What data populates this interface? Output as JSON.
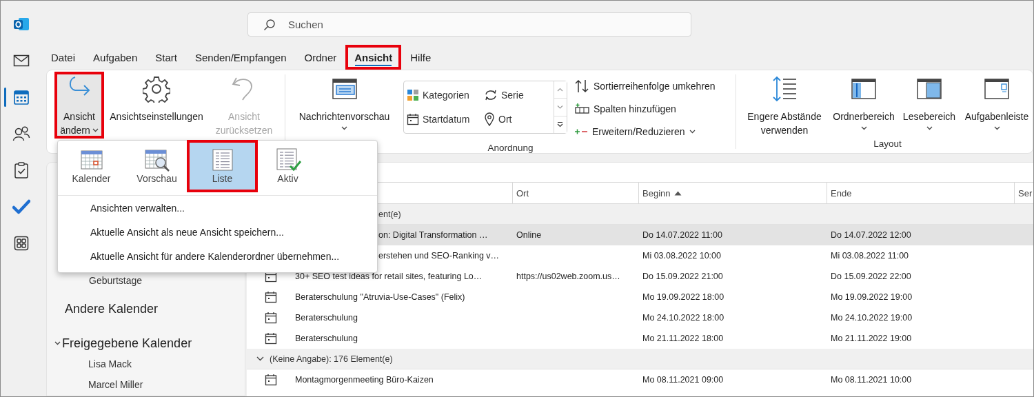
{
  "rail": [
    {
      "kind": "logo",
      "selected": false
    },
    {
      "kind": "mail",
      "selected": false
    },
    {
      "kind": "calendar",
      "selected": true
    },
    {
      "kind": "people",
      "selected": false
    },
    {
      "kind": "tasks",
      "selected": false
    },
    {
      "kind": "todo",
      "selected": false
    },
    {
      "kind": "apps",
      "selected": false
    }
  ],
  "search": {
    "placeholder": "Suchen"
  },
  "menu_tabs": [
    {
      "label": "Datei",
      "selected": false,
      "highlighted": false
    },
    {
      "label": "Aufgaben",
      "selected": false,
      "highlighted": false
    },
    {
      "label": "Start",
      "selected": false,
      "highlighted": false
    },
    {
      "label": "Senden/Empfangen",
      "selected": false,
      "highlighted": false
    },
    {
      "label": "Ordner",
      "selected": false,
      "highlighted": false
    },
    {
      "label": "Ansicht",
      "selected": true,
      "highlighted": true
    },
    {
      "label": "Hilfe",
      "selected": false,
      "highlighted": false
    }
  ],
  "ribbon": {
    "view_buttons": [
      {
        "lines": [
          "Ansicht",
          "ändern"
        ],
        "dropdown": true,
        "disabled": false,
        "highlighted": true
      },
      {
        "lines": [
          "Ansichtseinstellungen"
        ],
        "dropdown": false,
        "disabled": false,
        "highlighted": false
      },
      {
        "lines": [
          "Ansicht",
          "zurücksetzen"
        ],
        "dropdown": false,
        "disabled": true,
        "highlighted": false
      }
    ],
    "arrangement": {
      "label": "Anordnung",
      "preview_button": {
        "lines": [
          "Nachrichtenvorschau"
        ],
        "dropdown": true,
        "disabled": false,
        "highlighted": false
      },
      "gallery": [
        {
          "label": "Kategorien"
        },
        {
          "label": "Serie"
        },
        {
          "label": "Startdatum"
        },
        {
          "label": "Ort"
        }
      ],
      "commands": [
        {
          "label": "Sortierreihenfolge umkehren",
          "dropdown": false
        },
        {
          "label": "Spalten hinzufügen",
          "dropdown": false
        },
        {
          "label": "Erweitern/Reduzieren",
          "dropdown": true
        }
      ]
    },
    "layout": {
      "label": "Layout",
      "buttons": [
        {
          "lines": [
            "Engere Abstände",
            "verwenden"
          ],
          "dropdown": false,
          "disabled": false,
          "highlighted": false
        },
        {
          "lines": [
            "Ordnerbereich"
          ],
          "dropdown": true,
          "disabled": false,
          "highlighted": false
        },
        {
          "lines": [
            "Lesebereich"
          ],
          "dropdown": true,
          "disabled": false,
          "highlighted": false
        },
        {
          "lines": [
            "Aufgabenleiste"
          ],
          "dropdown": true,
          "disabled": false,
          "highlighted": false
        }
      ]
    }
  },
  "view_menu": {
    "views": [
      {
        "label": "Kalender",
        "selected": false,
        "highlighted": false
      },
      {
        "label": "Vorschau",
        "selected": false,
        "highlighted": false
      },
      {
        "label": "Liste",
        "selected": true,
        "highlighted": true
      },
      {
        "label": "Aktiv",
        "selected": false,
        "highlighted": false
      }
    ],
    "commands": [
      "Ansichten verwalten...",
      "Aktuelle Ansicht als neue Ansicht speichern...",
      "Aktuelle Ansicht für andere Kalenderordner übernehmen..."
    ]
  },
  "sidebar": {
    "items": [
      {
        "kind": "calendar",
        "label": "Geburtstage"
      },
      {
        "kind": "group",
        "label": "Andere Kalender"
      },
      {
        "kind": "group",
        "label": "Freigegebene Kalender",
        "expanded": true,
        "children": [
          {
            "label": "Lisa Mack"
          },
          {
            "label": "Marcel Miller"
          }
        ]
      }
    ]
  },
  "list": {
    "columns": [
      {
        "label": "Ort",
        "sorted": false
      },
      {
        "label": "Beginn",
        "sorted": true
      },
      {
        "label": "Ende",
        "sorted": false
      },
      {
        "label": "Ser",
        "sorted": false
      }
    ],
    "groups": [
      {
        "header": "ent(e)",
        "partial": true,
        "rows": [
          {
            "title": "on: Digital Transformation …",
            "location": "Online",
            "start": "Do 14.07.2022 11:00",
            "end": "Do 14.07.2022 12:00",
            "selected": true,
            "partial": true
          },
          {
            "title": "erstehen und SEO-Ranking v…",
            "start": "Mi 03.08.2022 10:00",
            "end": "Mi 03.08.2022 11:00",
            "selected": false,
            "partial": true
          },
          {
            "title": "30+ SEO test ideas for retail sites, featuring Lo…",
            "location": "https://us02web.zoom.us…",
            "start": "Do 15.09.2022 21:00",
            "end": "Do 15.09.2022 22:00",
            "selected": false,
            "partial": false
          },
          {
            "title": "Beraterschulung \"Atruvia-Use-Cases\" (Felix)",
            "start": "Mo 19.09.2022 18:00",
            "end": "Mo 19.09.2022 19:00",
            "selected": false,
            "partial": false
          },
          {
            "title": "Beraterschulung",
            "start": "Mo 24.10.2022 18:00",
            "end": "Mo 24.10.2022 19:00",
            "selected": false,
            "partial": false
          },
          {
            "title": "Beraterschulung",
            "start": "Mo 21.11.2022 18:00",
            "end": "Mo 21.11.2022 19:00",
            "selected": false,
            "partial": false
          }
        ]
      },
      {
        "header": "(Keine Angabe): 176 Element(e)",
        "partial": false,
        "rows": [
          {
            "title": "Montagmorgenmeeting Büro-Kaizen",
            "start": "Mo 08.11.2021 09:00",
            "end": "Mo 08.11.2021 10:00",
            "selected": false,
            "partial": false
          }
        ]
      }
    ]
  }
}
